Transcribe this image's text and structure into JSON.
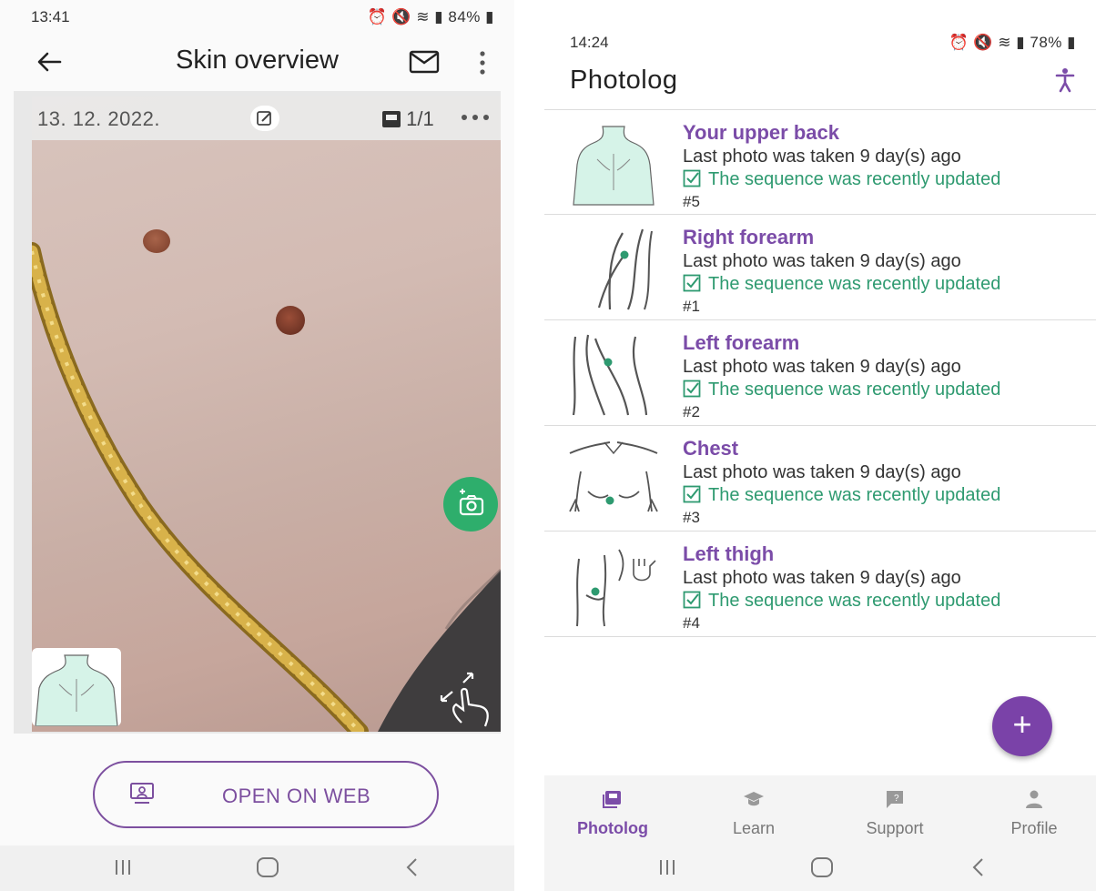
{
  "left_screen": {
    "status_bar": {
      "time": "13:41",
      "right": "84%"
    },
    "header": {
      "title": "Skin overview"
    },
    "photo": {
      "date": "13. 12. 2022.",
      "count": "1/1"
    },
    "open_web_label": "OPEN ON WEB"
  },
  "right_screen": {
    "status_bar": {
      "time": "14:24",
      "right": "78%"
    },
    "title": "Photolog",
    "entries": [
      {
        "title": "Your upper back",
        "subtitle": "Last photo was taken 9 day(s) ago",
        "status": "The sequence was recently updated",
        "number": "#5"
      },
      {
        "title": "Right forearm",
        "subtitle": "Last photo was taken 9 day(s) ago",
        "status": "The sequence was recently updated",
        "number": "#1"
      },
      {
        "title": "Left forearm",
        "subtitle": "Last photo was taken 9 day(s) ago",
        "status": "The sequence was recently updated",
        "number": "#2"
      },
      {
        "title": "Chest",
        "subtitle": "Last photo was taken 9 day(s) ago",
        "status": "The sequence was recently updated",
        "number": "#3"
      },
      {
        "title": "Left thigh",
        "subtitle": "Last photo was taken 9 day(s) ago",
        "status": "The sequence was recently updated",
        "number": "#4"
      }
    ],
    "tabs": [
      {
        "label": "Photolog",
        "icon": "photolog-icon"
      },
      {
        "label": "Learn",
        "icon": "graduation-cap-icon"
      },
      {
        "label": "Support",
        "icon": "support-chat-icon"
      },
      {
        "label": "Profile",
        "icon": "person-icon"
      }
    ],
    "active_tab": "Photolog"
  },
  "colors": {
    "accent_purple": "#7b4ca8",
    "accent_green": "#2e9a70",
    "fab_purple": "#7a42a8",
    "camera_green": "#2eae6c"
  }
}
